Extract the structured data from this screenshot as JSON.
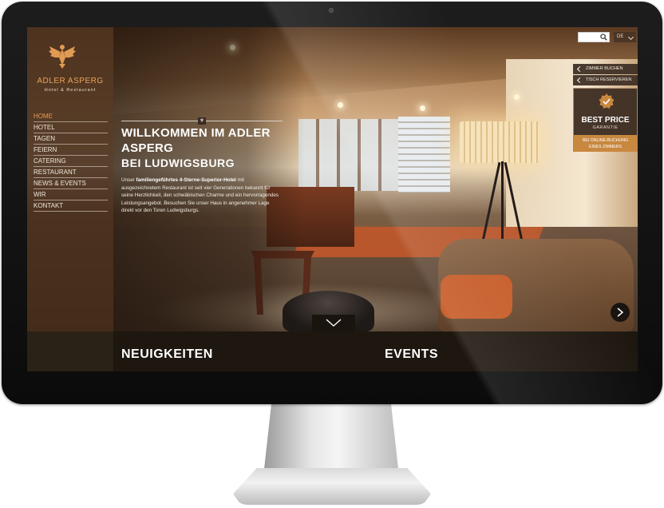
{
  "brand": {
    "name": "ADLER ASPERG",
    "subtitle": "Hotel & Restaurant"
  },
  "nav": {
    "items": [
      {
        "label": "HOME",
        "active": true
      },
      {
        "label": "HOTEL",
        "active": false
      },
      {
        "label": "TAGEN",
        "active": false
      },
      {
        "label": "FEIERN",
        "active": false
      },
      {
        "label": "CATERING",
        "active": false
      },
      {
        "label": "RESTAURANT",
        "active": false
      },
      {
        "label": "NEWS & EVENTS",
        "active": false
      },
      {
        "label": "WIR",
        "active": false
      },
      {
        "label": "KONTAKT",
        "active": false
      }
    ]
  },
  "welcome": {
    "title": "WILLKOMMEN IM ADLER ASPERG",
    "subtitle": "BEI LUDWIGSBURG",
    "body_prefix": "Unser ",
    "body_bold": "familiengeführtes 4-Sterne-Superior-Hotel",
    "body_rest": " mit ausgezeichnetem Restaurant ist seit vier Generationen bekannt für seine Herzlichkeit, den schwäbischen Charme und ein hervorragendes Leistungsangebot. Besuchen Sie unser Haus in angenehmer Lage direkt vor den Toren Ludwigsburgs."
  },
  "header": {
    "search_placeholder": "",
    "language": "DE"
  },
  "side_actions": {
    "book_room": "ZIMMER BUCHEN",
    "reserve_table": "TISCH RESERVIEREN"
  },
  "best_price": {
    "title": "BEST PRICE",
    "subtitle": "GARANTIE",
    "note_line1": "BEI ONLINE-BUCHUNG",
    "note_line2": "EINES ZIMMERS"
  },
  "sections": {
    "news": "NEUIGKEITEN",
    "events": "EVENTS"
  },
  "colors": {
    "accent": "#e89a4f",
    "sidebar_bg": "#462c1a",
    "bottom_bg": "#1e170f",
    "best_price_note": "#c8883f"
  },
  "icons": {
    "logo": "eagle-icon",
    "search": "search-icon",
    "language": "chevron-down-icon",
    "side_action": "chevron-left-icon",
    "best_price": "check-badge-icon",
    "next": "chevron-right-icon",
    "scroll": "chevron-down-icon"
  }
}
